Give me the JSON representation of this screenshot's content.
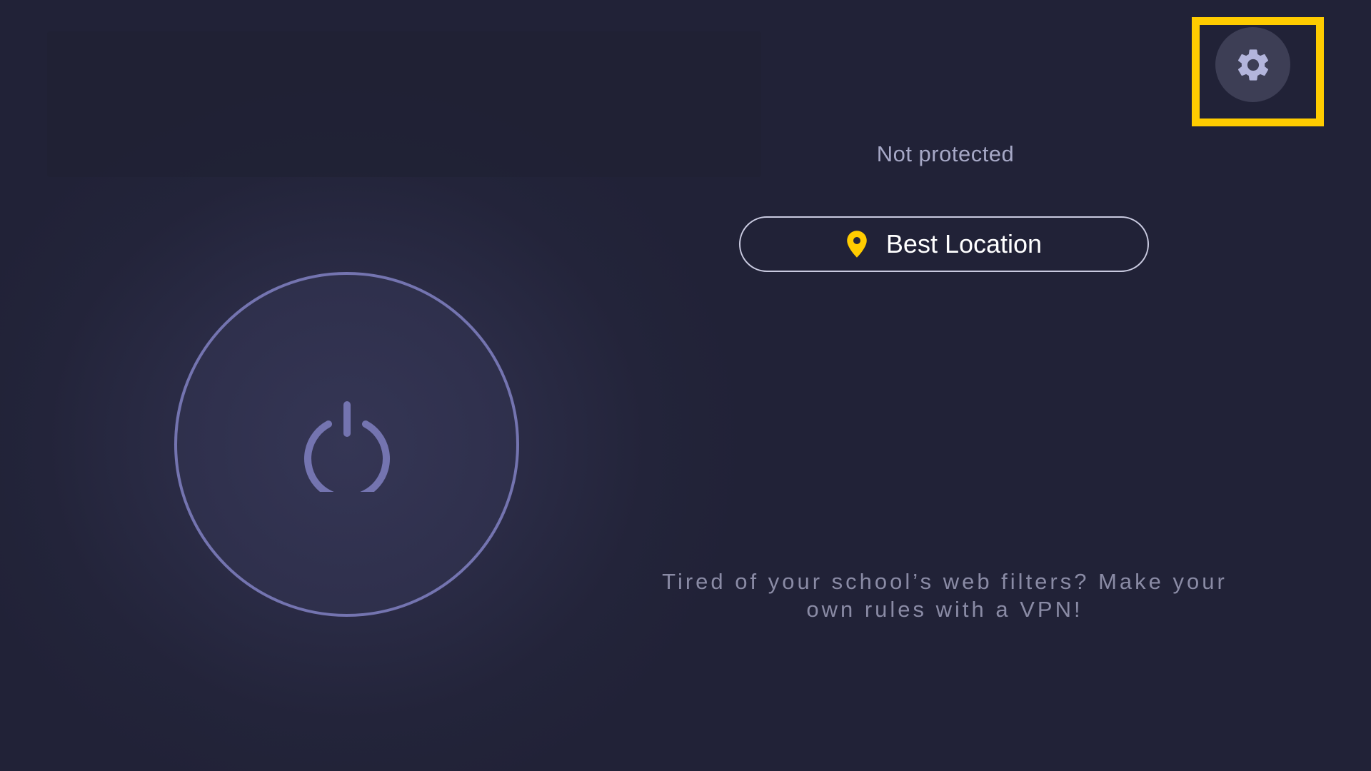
{
  "header": {
    "settings_icon": "gear-icon",
    "highlight_color": "#ffcc00"
  },
  "status": {
    "text": "Not protected"
  },
  "location": {
    "icon": "location-pin-icon",
    "label": "Best Location",
    "pin_color": "#ffcc00"
  },
  "connect": {
    "icon": "power-icon",
    "ring_color": "#7474b0"
  },
  "promo": {
    "text": "Tired of your school’s web filters? Make your own rules with a VPN!"
  }
}
